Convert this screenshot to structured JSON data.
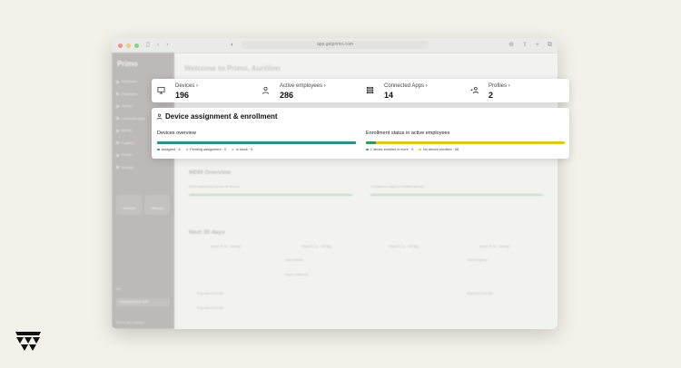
{
  "browser": {
    "url": "app.getprimo.com"
  },
  "sidebar": {
    "brand": "Primo",
    "items": [
      {
        "label": "Dashboard"
      },
      {
        "label": "Employees"
      },
      {
        "label": "My fleet"
      },
      {
        "label": "Connected apps"
      },
      {
        "label": "Activity"
      },
      {
        "label": "Logistics"
      },
      {
        "label": "Profiles"
      },
      {
        "label": "Settings"
      }
    ],
    "buttons": [
      {
        "label": "Onboard"
      },
      {
        "label": "Offboard"
      }
    ],
    "language": "EN",
    "account": "CompanyName SAS",
    "footer": "Hire in our employer"
  },
  "main": {
    "welcome": "Welcome to Primo, Aurélien",
    "mdm_title": "MDM Overview",
    "mdm_left": "MDM deployment across all devices",
    "mdm_right": "Compliance status of enrolled devices",
    "next_title": "Next 30 days",
    "weeks": [
      "Week 21  11 - 18 May",
      "Week 21  11 - 18 May",
      "Week 21  11 - 18 May",
      "Week 21  11 - 18 May"
    ],
    "people": [
      "Felix Ashford",
      "Maya Lockwood",
      "Zara Kingsley"
    ],
    "shipments": [
      "Shipment DXCJ08",
      "Shipment DXCJ08",
      "Shipment DXCJ08"
    ]
  },
  "kpis": [
    {
      "label": "Devices",
      "value": "196",
      "icon": "monitor-icon"
    },
    {
      "label": "Active employees",
      "value": "286",
      "icon": "person-icon"
    },
    {
      "label": "Connected Apps",
      "value": "14",
      "icon": "apps-grid-icon"
    },
    {
      "label": "Profiles",
      "value": "2",
      "icon": "profiles-icon"
    }
  ],
  "assignment": {
    "title": "Device assignment & enrollment",
    "devices_overview": {
      "title": "Devices overview",
      "legend": [
        {
          "label": "Assigned · 6",
          "color": "#2e8f8c"
        },
        {
          "label": "Pending assignment · 0",
          "color": "#8fbfbd"
        },
        {
          "label": "In stock · 0",
          "color": "#cfcfcf"
        }
      ],
      "fraction_assigned": 1.0
    },
    "enrollment": {
      "title": "Enrollment status in active employees",
      "legend": [
        {
          "label": "1 device enrolled in more · 5",
          "color": "#2f9a59"
        },
        {
          "label": "No device enrolled · 88",
          "color": "#e3c51d"
        }
      ],
      "fraction_enrolled": 0.05
    }
  },
  "colors": {
    "teal": "#2e8f8c",
    "green": "#2f9a59",
    "yellow": "#e3c51d",
    "background": "#f4f1ea"
  }
}
